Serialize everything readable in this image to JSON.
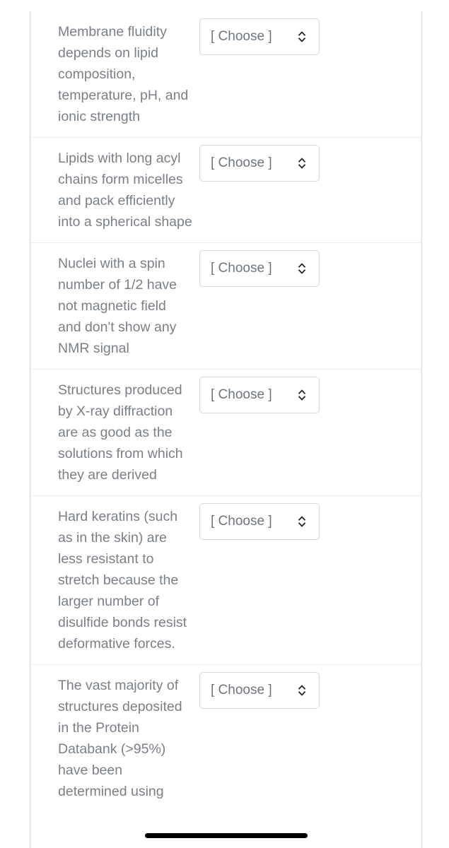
{
  "page": {
    "background_color": "#ffffff",
    "frame_border_color": "#d8dadd",
    "separator_color": "#eceded",
    "text_color": "#7a8086",
    "select_border_color": "#d5d8dc",
    "scroll_indicator_color": "#000000"
  },
  "select_defaults": {
    "placeholder": "[ Choose ]",
    "chevron_icon": "chevron-up-down-icon"
  },
  "questions": [
    {
      "id": "q1",
      "prompt": "Membrane fluidity depends on lipid composition, temperature, pH, and ionic strength",
      "answer": "[ Choose ]"
    },
    {
      "id": "q2",
      "prompt": "Lipids with long acyl chains form micelles and pack efficiently into a spherical shape",
      "answer": "[ Choose ]"
    },
    {
      "id": "q3",
      "prompt": "Nuclei with a spin number of 1/2 have not magnetic field and don't show any NMR signal",
      "answer": "[ Choose ]"
    },
    {
      "id": "q4",
      "prompt": "Structures produced by X-ray diffraction are as good as the solutions from which they are derived",
      "answer": "[ Choose ]"
    },
    {
      "id": "q5",
      "prompt": "Hard keratins (such as in the skin) are less resistant to stretch because the larger number of disulfide bonds resist deformative forces.",
      "answer": "[ Choose ]"
    },
    {
      "id": "q6",
      "prompt": "The vast majority of structures deposited in the Protein Databank (>95%) have been determined using",
      "answer": "[ Choose ]"
    }
  ]
}
